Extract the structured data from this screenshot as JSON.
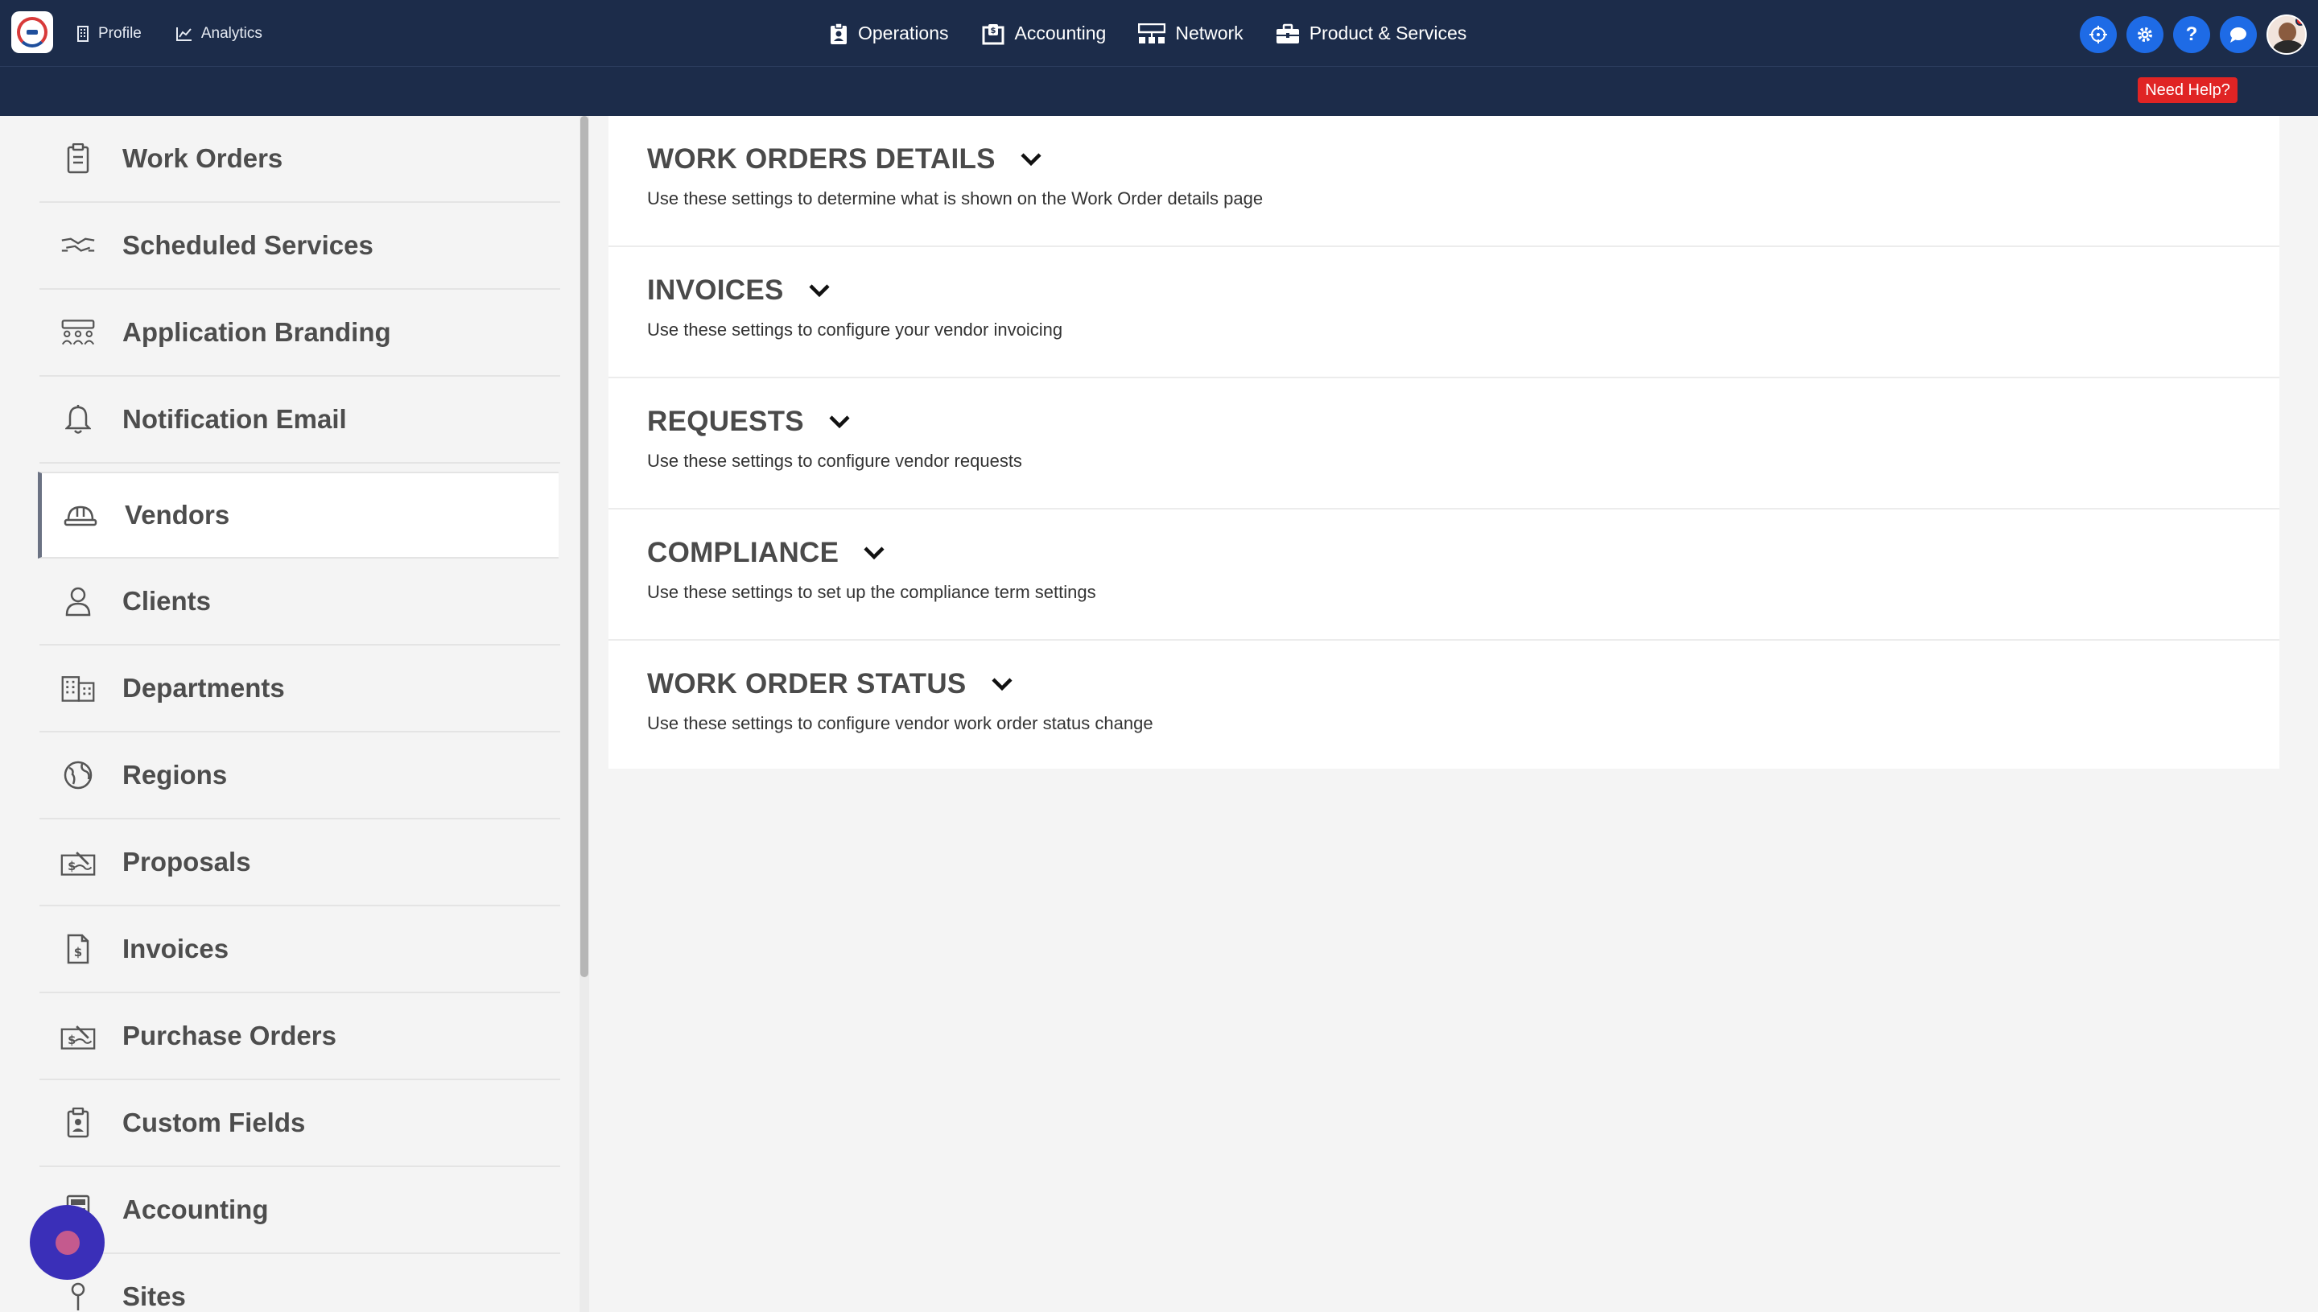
{
  "topnav": {
    "left": [
      {
        "label": "Profile",
        "icon": "building-icon"
      },
      {
        "label": "Analytics",
        "icon": "chart-line-icon"
      }
    ],
    "center": [
      {
        "label": "Operations",
        "icon": "clipboard-user-icon"
      },
      {
        "label": "Accounting",
        "icon": "money-box-icon"
      },
      {
        "label": "Network",
        "icon": "network-icon"
      },
      {
        "label": "Product & Services",
        "icon": "briefcase-icon"
      }
    ],
    "need_help": "Need Help?",
    "help_glyph": "?"
  },
  "sidebar": {
    "items": [
      {
        "label": "Work Orders",
        "icon": "clipboard-list-icon"
      },
      {
        "label": "Scheduled Services",
        "icon": "handshake-icon"
      },
      {
        "label": "Application Branding",
        "icon": "people-group-icon"
      },
      {
        "label": "Notification Email",
        "icon": "bell-icon"
      },
      {
        "label": "Vendors",
        "icon": "hard-hat-icon",
        "active": true
      },
      {
        "label": "Clients",
        "icon": "user-icon"
      },
      {
        "label": "Departments",
        "icon": "buildings-icon"
      },
      {
        "label": "Regions",
        "icon": "globe-icon"
      },
      {
        "label": "Proposals",
        "icon": "signature-dollar-icon"
      },
      {
        "label": "Invoices",
        "icon": "file-invoice-dollar-icon"
      },
      {
        "label": "Purchase Orders",
        "icon": "signature-dollar-icon"
      },
      {
        "label": "Custom Fields",
        "icon": "clipboard-user-icon"
      },
      {
        "label": "Accounting",
        "icon": "calculator-icon"
      },
      {
        "label": "Sites",
        "icon": "map-pin-icon"
      }
    ]
  },
  "sections": [
    {
      "title": "WORK ORDERS DETAILS",
      "desc": "Use these settings to determine what is shown on the Work Order details page"
    },
    {
      "title": "INVOICES",
      "desc": "Use these settings to configure your vendor invoicing"
    },
    {
      "title": "REQUESTS",
      "desc": "Use these settings to configure vendor requests"
    },
    {
      "title": "COMPLIANCE",
      "desc": "Use these settings to set up the compliance term settings"
    },
    {
      "title": "WORK ORDER STATUS",
      "desc": "Use these settings to configure vendor work order status change"
    }
  ],
  "colors": {
    "topbar": "#1c2c4a",
    "accent_blue": "#1e6be6",
    "help_red": "#e02424"
  }
}
